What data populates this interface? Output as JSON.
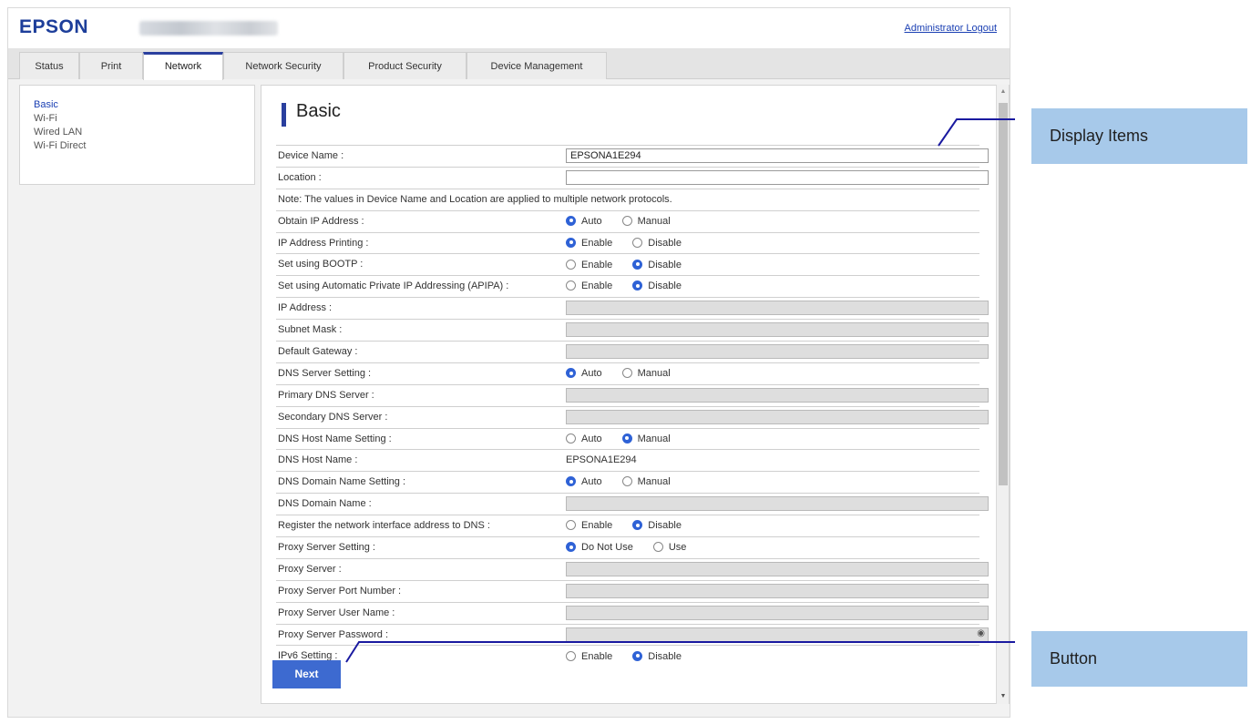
{
  "header": {
    "logo": "EPSON",
    "logout_link": "Administrator Logout"
  },
  "tabs": [
    {
      "label": "Status",
      "active": false
    },
    {
      "label": "Print",
      "active": false
    },
    {
      "label": "Network",
      "active": true
    },
    {
      "label": "Network Security",
      "active": false
    },
    {
      "label": "Product Security",
      "active": false
    },
    {
      "label": "Device Management",
      "active": false
    }
  ],
  "sidebar": {
    "items": [
      {
        "label": "Basic",
        "active": true
      },
      {
        "label": "Wi-Fi",
        "active": false
      },
      {
        "label": "Wired LAN",
        "active": false
      },
      {
        "label": "Wi-Fi Direct",
        "active": false
      }
    ]
  },
  "main": {
    "title": "Basic",
    "rows": [
      {
        "label": "Device Name :",
        "type": "input",
        "value": "EPSONA1E294",
        "disabled": false
      },
      {
        "label": "Location :",
        "type": "input",
        "value": "",
        "disabled": false
      },
      {
        "type": "note",
        "text": "Note: The values in Device Name and Location are applied to multiple network protocols."
      },
      {
        "label": "Obtain IP Address :",
        "type": "radio",
        "options": [
          "Auto",
          "Manual"
        ],
        "selected": 0
      },
      {
        "label": "IP Address Printing :",
        "type": "radio",
        "options": [
          "Enable",
          "Disable"
        ],
        "selected": 0
      },
      {
        "label": "Set using BOOTP :",
        "type": "radio",
        "options": [
          "Enable",
          "Disable"
        ],
        "selected": 1
      },
      {
        "label": "Set using Automatic Private IP Addressing (APIPA) :",
        "type": "radio",
        "options": [
          "Enable",
          "Disable"
        ],
        "selected": 1
      },
      {
        "label": "IP Address :",
        "type": "input",
        "value": "",
        "disabled": true
      },
      {
        "label": "Subnet Mask :",
        "type": "input",
        "value": "",
        "disabled": true
      },
      {
        "label": "Default Gateway :",
        "type": "input",
        "value": "",
        "disabled": true
      },
      {
        "label": "DNS Server Setting :",
        "type": "radio",
        "options": [
          "Auto",
          "Manual"
        ],
        "selected": 0
      },
      {
        "label": "Primary DNS Server :",
        "type": "input",
        "value": "",
        "disabled": true
      },
      {
        "label": "Secondary DNS Server :",
        "type": "input",
        "value": "",
        "disabled": true
      },
      {
        "label": "DNS Host Name Setting :",
        "type": "radio",
        "options": [
          "Auto",
          "Manual"
        ],
        "selected": 1
      },
      {
        "label": "DNS Host Name :",
        "type": "text",
        "value": "EPSONA1E294"
      },
      {
        "label": "DNS Domain Name Setting :",
        "type": "radio",
        "options": [
          "Auto",
          "Manual"
        ],
        "selected": 0
      },
      {
        "label": "DNS Domain Name :",
        "type": "input",
        "value": "",
        "disabled": true
      },
      {
        "label": "Register the network interface address to DNS :",
        "type": "radio",
        "options": [
          "Enable",
          "Disable"
        ],
        "selected": 1
      },
      {
        "label": "Proxy Server Setting :",
        "type": "radio",
        "options": [
          "Do Not Use",
          "Use"
        ],
        "selected": 0
      },
      {
        "label": "Proxy Server :",
        "type": "input",
        "value": "",
        "disabled": true
      },
      {
        "label": "Proxy Server Port Number :",
        "type": "input",
        "value": "",
        "disabled": true
      },
      {
        "label": "Proxy Server User Name :",
        "type": "input",
        "value": "",
        "disabled": true
      },
      {
        "label": "Proxy Server Password :",
        "type": "password",
        "value": "",
        "disabled": true
      },
      {
        "label": "IPv6 Setting :",
        "type": "radio",
        "options": [
          "Enable",
          "Disable"
        ],
        "selected": 1
      }
    ],
    "next_button": "Next"
  },
  "callouts": {
    "display_items": "Display Items",
    "button": "Button"
  },
  "colors": {
    "brand_blue": "#1d3e9a",
    "accent_blue": "#3d6ad0",
    "callout_bg": "#a7c9ea",
    "leader_line": "#1a1aa0"
  },
  "icons": {
    "password_reveal": "eye-icon",
    "scroll_up": "scroll-up-arrow-icon",
    "scroll_down": "scroll-down-arrow-icon"
  }
}
